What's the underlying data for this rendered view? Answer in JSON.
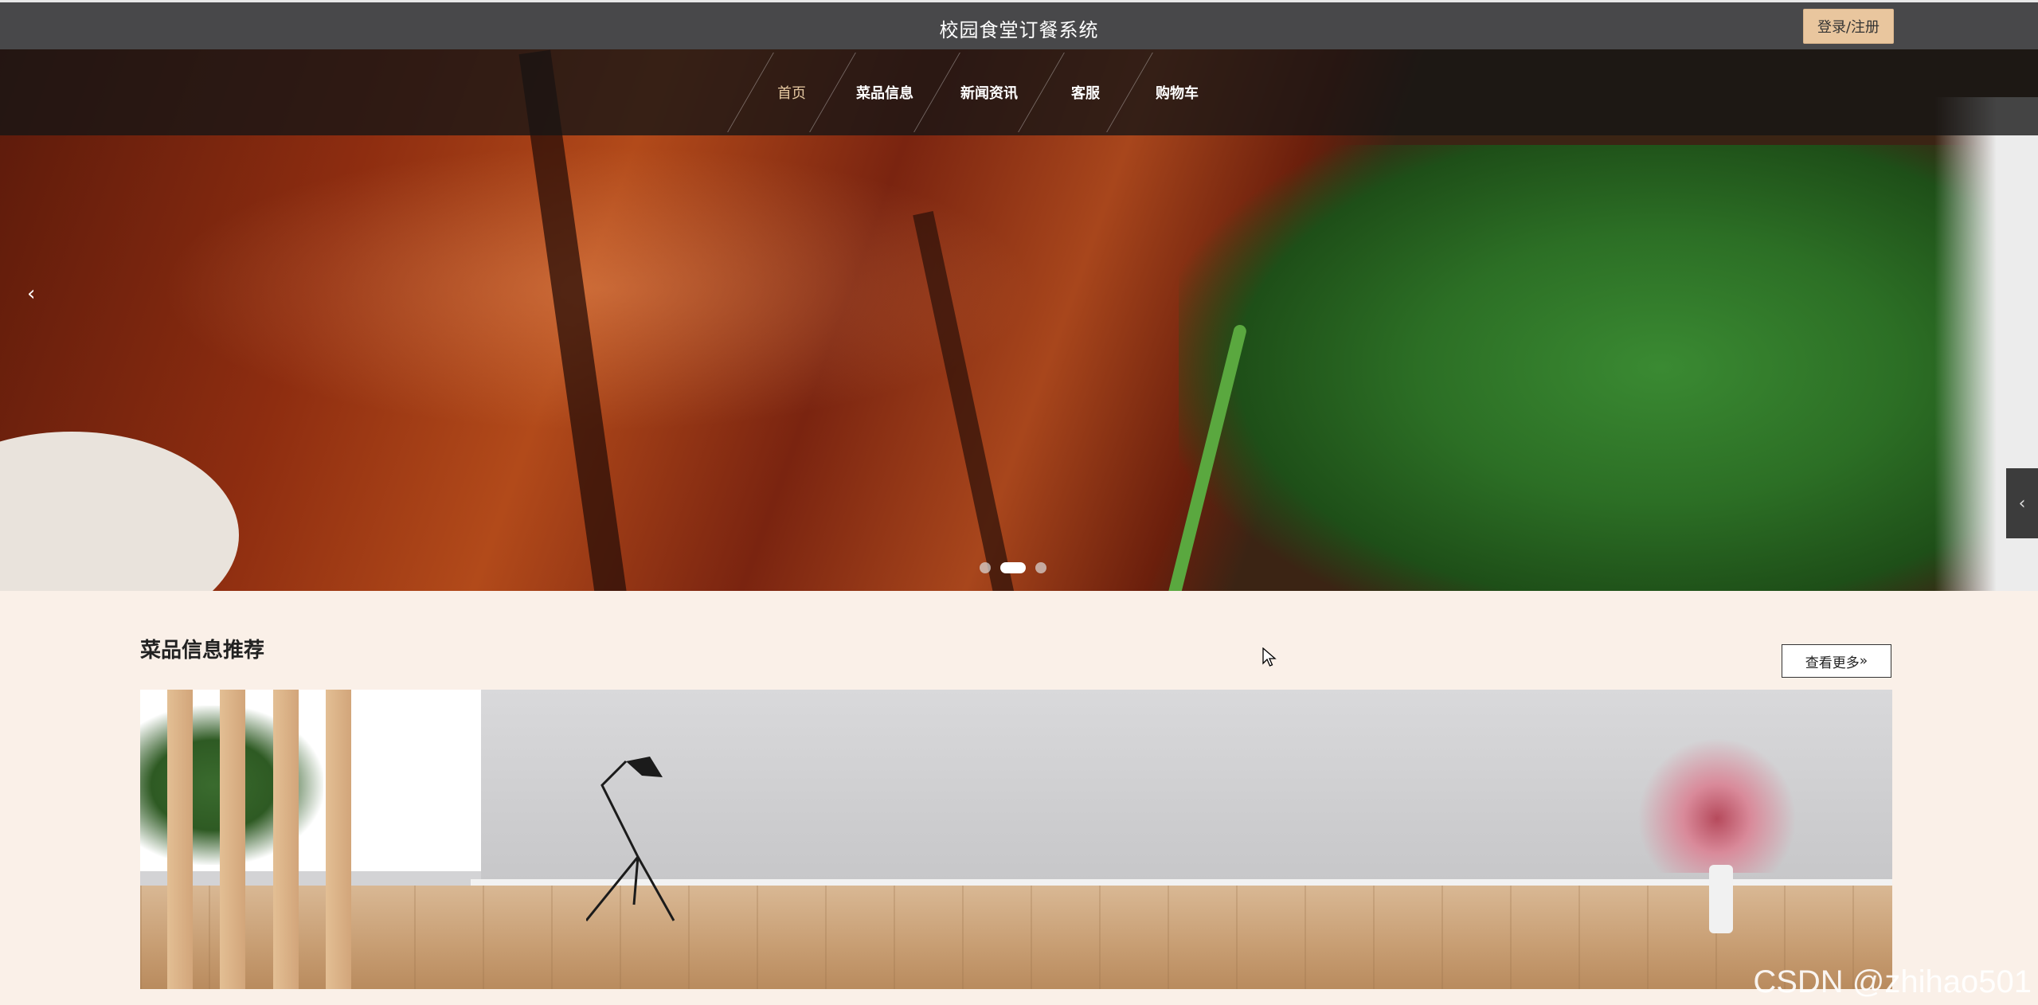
{
  "header": {
    "site_title": "校园食堂订餐系统",
    "login_label": "登录/注册"
  },
  "nav": {
    "items": [
      {
        "label": "首页",
        "active": true
      },
      {
        "label": "菜品信息",
        "active": false
      },
      {
        "label": "新闻资讯",
        "active": false
      },
      {
        "label": "客服",
        "active": false
      },
      {
        "label": "购物车",
        "active": false
      }
    ]
  },
  "carousel": {
    "slide_count": 3,
    "active_index": 1,
    "prev_icon": "chevron-left-icon",
    "side_tab_icon": "chevron-left-icon"
  },
  "section": {
    "title": "菜品信息推荐",
    "more_label": "查看更多",
    "more_icon": "double-chevron-right-icon"
  },
  "watermark": "CSDN @zhihao501",
  "colors": {
    "topbar": "#48484a",
    "accent": "#e9c69e",
    "active_nav": "#e6c9a2",
    "page_bg": "#faf0e8"
  }
}
